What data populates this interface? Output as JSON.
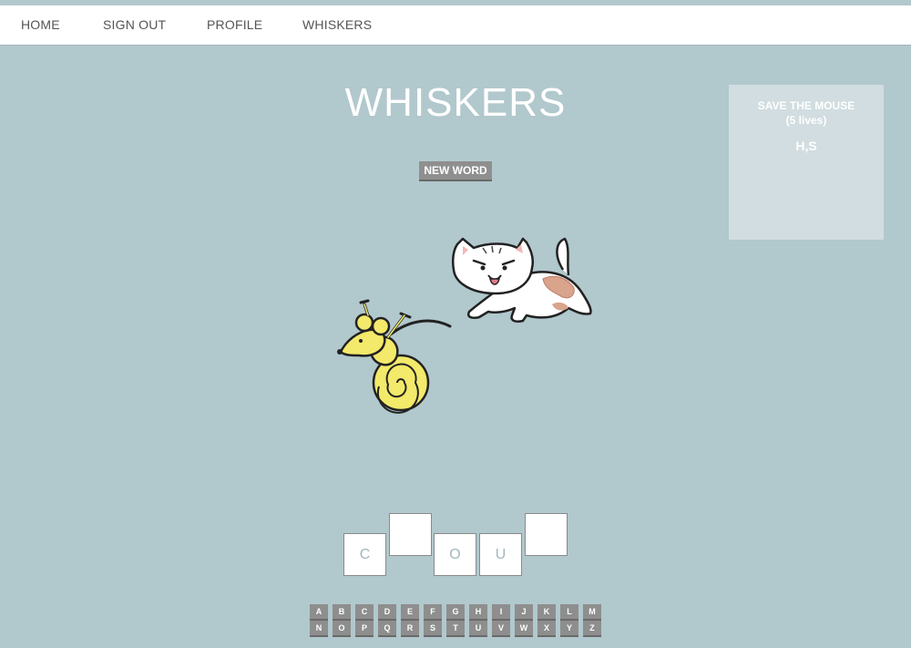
{
  "nav": {
    "home": "HOME",
    "sign_out": "SIGN OUT",
    "profile": "PROFILE",
    "whiskers": "WHISKERS"
  },
  "game": {
    "title": "WHISKERS",
    "new_word_label": "NEW WORD"
  },
  "scoreboard": {
    "title": "SAVE THE MOUSE",
    "lives": "(5 lives)",
    "guessed_letters": "H,S"
  },
  "word_tiles": [
    "C",
    "",
    "O",
    "U",
    ""
  ],
  "keyboard": {
    "row1": [
      "A",
      "B",
      "C",
      "D",
      "E",
      "F",
      "G",
      "H",
      "I",
      "J",
      "K",
      "L",
      "M"
    ],
    "row2": [
      "N",
      "O",
      "P",
      "Q",
      "R",
      "S",
      "T",
      "U",
      "V",
      "W",
      "X",
      "Y",
      "Z"
    ]
  },
  "colors": {
    "background": "#b1c8cd",
    "key": "#8e8e8e",
    "scorebox": "#d1dde0"
  }
}
